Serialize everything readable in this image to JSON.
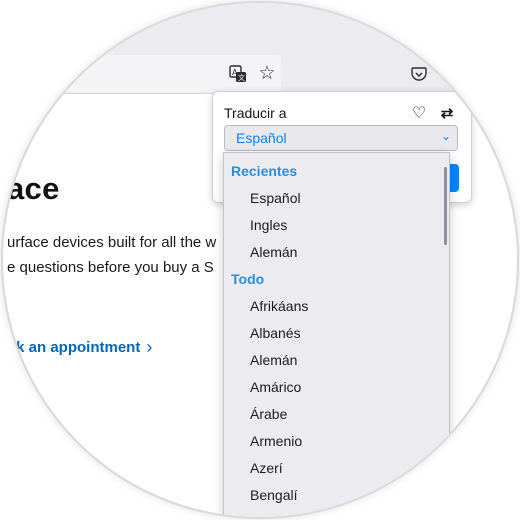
{
  "toolbar": {
    "translate_icon": "translate-icon",
    "star_icon": "star-icon",
    "pocket_icon": "pocket-icon"
  },
  "page": {
    "heading": "ace",
    "line1": "urface devices built for all the w",
    "line2": "e questions before you buy a S",
    "link": "ok an appointment",
    "link_color": "#0067b8"
  },
  "translate_panel": {
    "title": "Traducir a",
    "selected_language": "Español",
    "heart_icon": "heart-icon",
    "swap_icon": "swap-icon",
    "accent_color": "#0a84ff"
  },
  "dropdown": {
    "groups": [
      {
        "label": "Recientes",
        "items": [
          "Español",
          "Ingles",
          "Alemán"
        ]
      },
      {
        "label": "Todo",
        "items": [
          "Afrikáans",
          "Albanés",
          "Alemán",
          "Amárico",
          "Árabe",
          "Armenio",
          "Azerí",
          "Bengalí"
        ]
      }
    ]
  }
}
